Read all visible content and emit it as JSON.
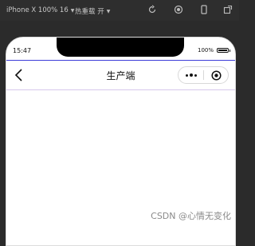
{
  "toolbar": {
    "device_label": "iPhone X 100% 16",
    "reload_label": "热重载 开",
    "icons": [
      "rotate-icon",
      "record-icon",
      "phone-icon",
      "popout-icon"
    ]
  },
  "status_bar": {
    "time": "15:47",
    "battery": "100%",
    "battery_level": 1.0
  },
  "navbar": {
    "title": "生产端",
    "back_icon": "chevron-left-icon",
    "more_icon": "more-dots-icon",
    "close_icon": "target-circle-icon"
  },
  "watermark": "CSDN @心情无变化",
  "colors": {
    "status_line": "#3d3dd9",
    "nav_divider": "#d6c8ec",
    "toolbar_bg": "#2e2e2e"
  }
}
